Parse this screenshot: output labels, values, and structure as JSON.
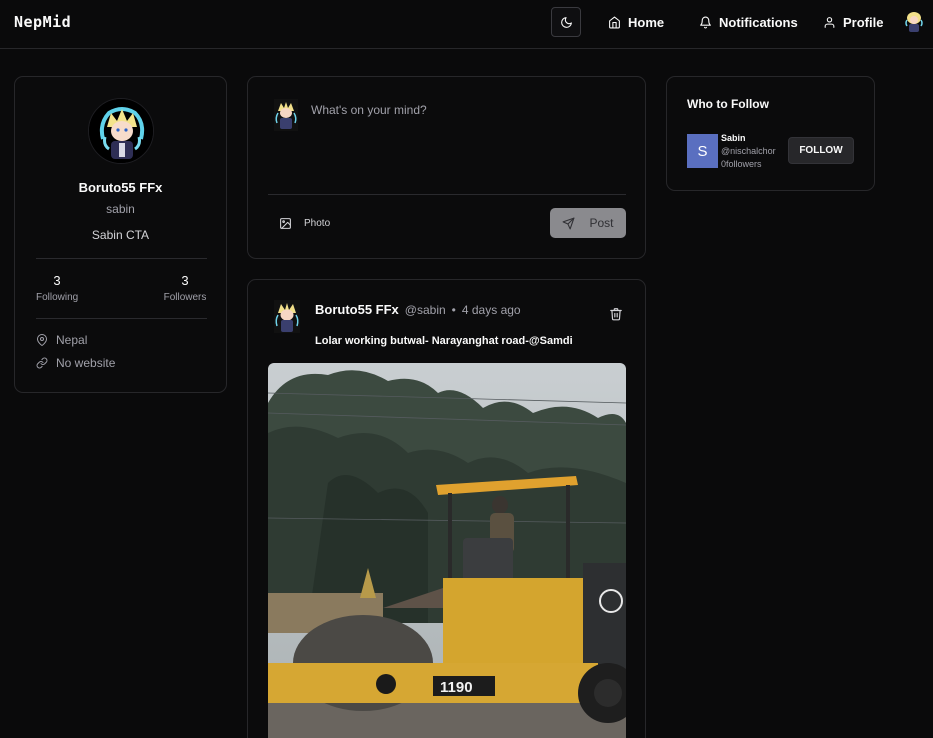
{
  "header": {
    "brand": "NepMid",
    "nav": {
      "home": "Home",
      "notifications": "Notifications",
      "profile": "Profile"
    }
  },
  "profile": {
    "display_name": "Boruto55 FFx",
    "username": "sabin",
    "bio": "Sabin CTA",
    "following_count": "3",
    "following_label": "Following",
    "followers_count": "3",
    "followers_label": "Followers",
    "location": "Nepal",
    "website": "No website"
  },
  "composer": {
    "placeholder": "What's on your mind?",
    "photo_label": "Photo",
    "post_label": "Post"
  },
  "post": {
    "author": "Boruto55 FFx",
    "handle": "@sabin",
    "separator": "•",
    "time": "4 days ago",
    "text": "Lolar working butwal- Narayanghat road-@Samdi",
    "image_label": "1190"
  },
  "who_to_follow": {
    "title": "Who to Follow",
    "suggestion": {
      "avatar_letter": "S",
      "name": "Sabin",
      "handle": "@nischalchor",
      "followers": "0followers",
      "follow_label": "FOLLOW"
    }
  },
  "colors": {
    "background": "#0a0a0b",
    "border": "#27272a",
    "muted_text": "#a1a1aa",
    "suggest_avatar": "#5a6fc0",
    "post_button": "#8a8a8e"
  },
  "icons": [
    "moon-icon",
    "home-icon",
    "bell-icon",
    "user-icon",
    "map-pin-icon",
    "link-icon",
    "image-icon",
    "send-icon",
    "trash-icon"
  ]
}
